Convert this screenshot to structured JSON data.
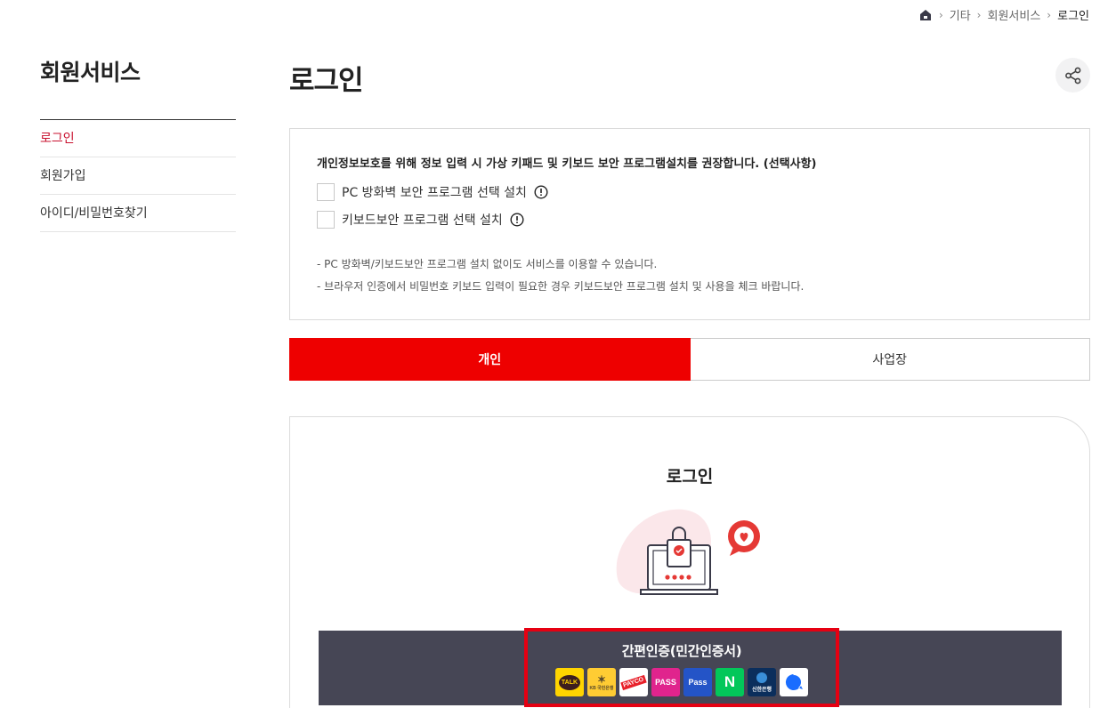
{
  "breadcrumb": {
    "items": [
      "기타",
      "회원서비스"
    ],
    "current": "로그인"
  },
  "sidebar": {
    "title": "회원서비스",
    "items": [
      {
        "label": "로그인"
      },
      {
        "label": "회원가입"
      },
      {
        "label": "아이디/비밀번호찾기"
      }
    ]
  },
  "main": {
    "title": "로그인"
  },
  "notice": {
    "heading": "개인정보보호를 위해 정보 입력 시 가상 키패드 및 키보드 보안 프로그램설치를 권장합니다. (선택사항)",
    "options": [
      {
        "label": "PC 방화벽 보안 프로그램 선택 설치"
      },
      {
        "label": "키보드보안 프로그램 선택 설치"
      }
    ],
    "bullets": [
      "PC 방화벽/키보드보안 프로그램 설치 없이도 서비스를 이용할 수 있습니다.",
      "브라우저 인증에서 비밀번호 키보드 입력이 필요한 경우 키보드보안 프로그램 설치 및 사용을 체크 바랍니다."
    ]
  },
  "tabs": [
    {
      "label": "개인",
      "active": true
    },
    {
      "label": "사업장",
      "active": false
    }
  ],
  "login_card": {
    "title": "로그인",
    "cert_label": "간편인증(민간인증서)",
    "providers": [
      {
        "name": "kakao",
        "text": "TALK"
      },
      {
        "name": "kb",
        "text": "KB 국민은행"
      },
      {
        "name": "payco",
        "text": "PAYCO"
      },
      {
        "name": "pass",
        "text": "PASS"
      },
      {
        "name": "samsung-pass",
        "text": "Pass"
      },
      {
        "name": "naver",
        "text": "N"
      },
      {
        "name": "shinhan",
        "text": "신한은행"
      },
      {
        "name": "toss",
        "text": ""
      }
    ]
  },
  "colors": {
    "accent": "#ee0000",
    "sidebar_active": "#c8102e",
    "cert_bar": "#464655",
    "highlight": "#e60012"
  }
}
